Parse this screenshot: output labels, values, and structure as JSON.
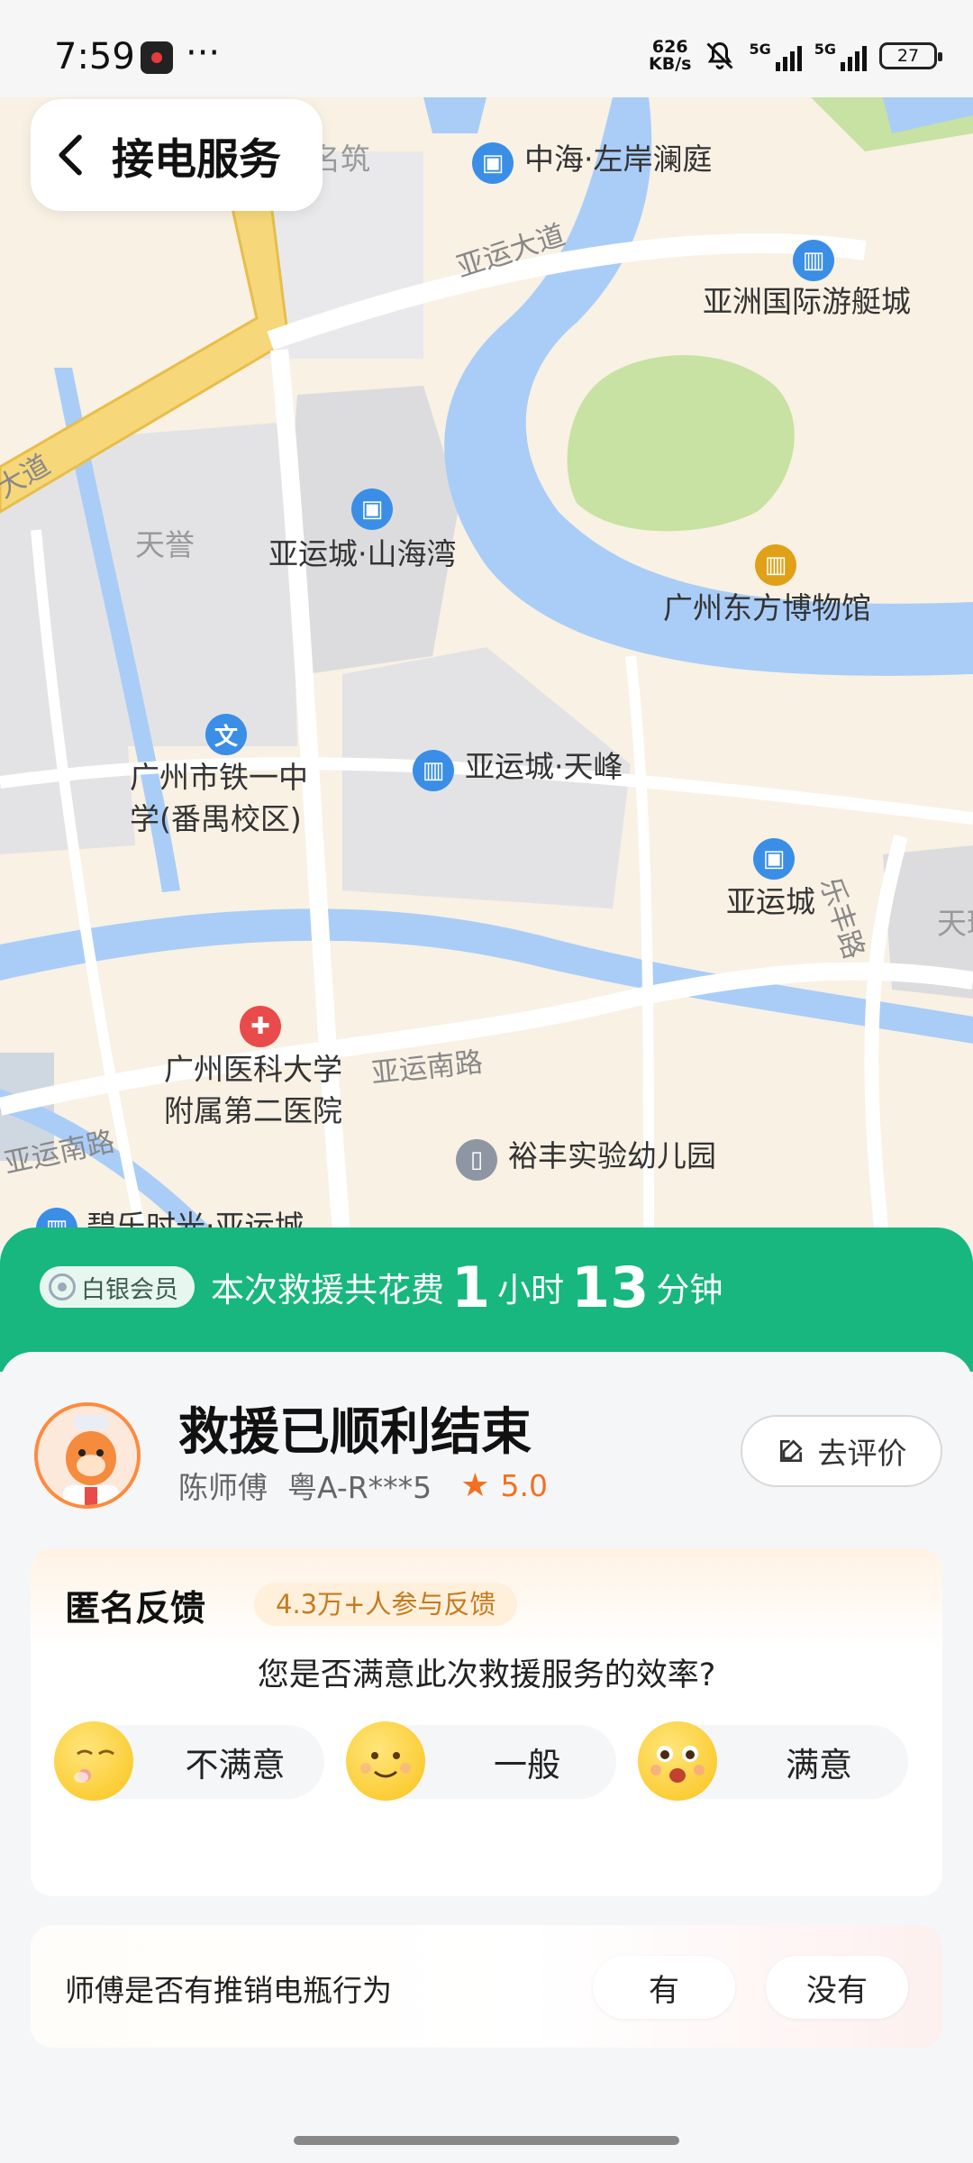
{
  "status_bar": {
    "time": "7:59",
    "dots": "···",
    "speed_value": "626",
    "speed_unit": "KB/s",
    "net1": "5G",
    "net2": "5G",
    "battery": "27"
  },
  "header": {
    "back_icon": "chevron-left-icon",
    "title": "接电服务"
  },
  "map": {
    "labels": {
      "zhonghai": "中海·左岸澜庭",
      "yazhou_yacht": "亚洲国际游艇城",
      "yayun_ave": "亚运大道",
      "da_dao_left": "大道",
      "tianyu": "天誉",
      "shanhaiwan": "亚运城·山海湾",
      "museum": "广州东方博物馆",
      "tianfeng": "亚运城·天峰",
      "tieyi_line1": "广州市铁一中",
      "tieyi_line2": "学(番禺校区)",
      "yayuncheng": "亚运城",
      "lefeng_road": "乐丰路",
      "tian_right": "天瑞",
      "hospital_line1": "广州医科大学",
      "hospital_line2": "附属第二医院",
      "yayun_south_road": "亚运南路",
      "yayun_south_road2": "亚运南路",
      "kindergarten": "裕丰实验幼儿园",
      "bilezhu": "碧乐时光·亚运城",
      "mingzhu": "名筑"
    },
    "poi_icons": {
      "building": "building-icon",
      "school": "school-icon",
      "museum": "museum-icon",
      "hospital": "hospital-icon",
      "kindergarten": "kindergarten-icon"
    }
  },
  "banner": {
    "badge": "白银会员",
    "prefix": "本次救援共花费",
    "hours": "1",
    "hours_unit": "小时",
    "minutes": "13",
    "minutes_unit": "分钟",
    "color": "#17b77f"
  },
  "status_card": {
    "title": "救援已顺利结束",
    "driver": "陈师傅",
    "plate": "粤A-R***5",
    "rating": "5.0",
    "review_button": "去评价"
  },
  "feedback": {
    "title": "匿名反馈",
    "participants": "4.3万+人参与反馈",
    "question": "您是否满意此次救援服务的效率?",
    "options": [
      {
        "label": "不满意",
        "icon": "sleepy-face-icon"
      },
      {
        "label": "一般",
        "icon": "smile-face-icon"
      },
      {
        "label": "满意",
        "icon": "surprised-face-icon"
      }
    ]
  },
  "push_sell": {
    "question": "师傅是否有推销电瓶行为",
    "yes": "有",
    "no": "没有"
  }
}
